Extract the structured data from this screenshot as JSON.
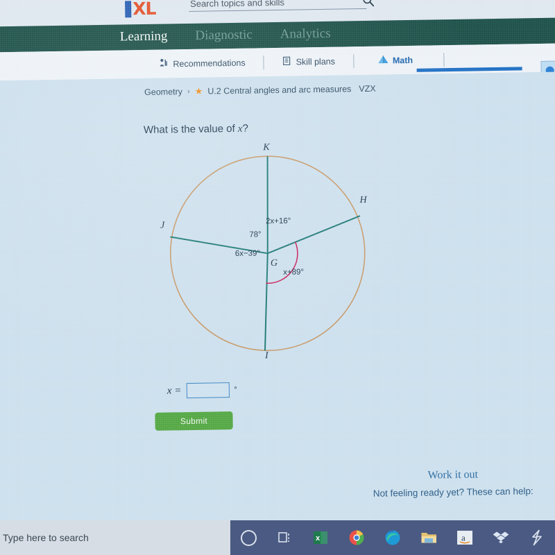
{
  "search": {
    "placeholder": "Search topics and skills",
    "value": "",
    "icon": "search-icon"
  },
  "brand": {
    "logo_i": "I",
    "logo_xl": "XL"
  },
  "primary_nav": {
    "items": [
      {
        "label": "Learning",
        "active": true
      },
      {
        "label": "Diagnostic",
        "active": false
      },
      {
        "label": "Analytics",
        "active": false
      }
    ]
  },
  "sub_nav": {
    "items": [
      {
        "label": "Recommendations",
        "icon": "recommendations-icon",
        "active": false
      },
      {
        "label": "Skill plans",
        "icon": "skill-plans-icon",
        "active": false
      },
      {
        "label": "Math",
        "icon": "math-pyramid-icon",
        "active": true
      }
    ]
  },
  "breadcrumb": {
    "subject": "Geometry",
    "separator": "›",
    "star": "★",
    "skill": "U.2 Central angles and arc measures",
    "code": "VZX"
  },
  "question": {
    "text_before": "What is the value of ",
    "variable": "x",
    "text_after": "?"
  },
  "figure": {
    "center_label": "G",
    "vertices": [
      {
        "name": "K",
        "position": "top"
      },
      {
        "name": "H",
        "position": "upper-right"
      },
      {
        "name": "J",
        "position": "left"
      },
      {
        "name": "I",
        "position": "bottom"
      }
    ],
    "angles": [
      {
        "label": "78°",
        "between": "J-G-K"
      },
      {
        "label": "2x+16°",
        "between": "K-G-H"
      },
      {
        "label": "x+89°",
        "between": "H-G-I",
        "marked": true
      },
      {
        "label": "6x−39°",
        "between": "I-G-J"
      }
    ],
    "colors": {
      "circle": "#c79a6a",
      "radius": "#1f7a77",
      "arc_mark": "#c9275f",
      "label": "#243a52"
    }
  },
  "answer": {
    "prefix": "x =",
    "value": "",
    "unit": "°"
  },
  "submit": {
    "label": "Submit"
  },
  "work_it_out": {
    "title": "Work it out",
    "subtitle": "Not feeling ready yet? These can help:"
  },
  "taskbar": {
    "search_placeholder": "Type here to search",
    "icons": [
      {
        "name": "cortana-icon",
        "glyph": ""
      },
      {
        "name": "task-view-icon",
        "glyph": ""
      },
      {
        "name": "excel-icon",
        "glyph": "x"
      },
      {
        "name": "chrome-icon",
        "glyph": ""
      },
      {
        "name": "edge-icon",
        "glyph": ""
      },
      {
        "name": "file-explorer-icon",
        "glyph": ""
      },
      {
        "name": "amazon-icon",
        "glyph": "a"
      },
      {
        "name": "dropbox-icon",
        "glyph": ""
      },
      {
        "name": "lightning-s-icon",
        "glyph": ""
      }
    ]
  },
  "colors": {
    "green_nav": "#1d5149",
    "content_bg": "#cde0ed",
    "accent_blue": "#1f6fc4",
    "submit_green": "#55a845",
    "logo_blue": "#2a5fb4",
    "logo_orange": "#e2522c"
  }
}
